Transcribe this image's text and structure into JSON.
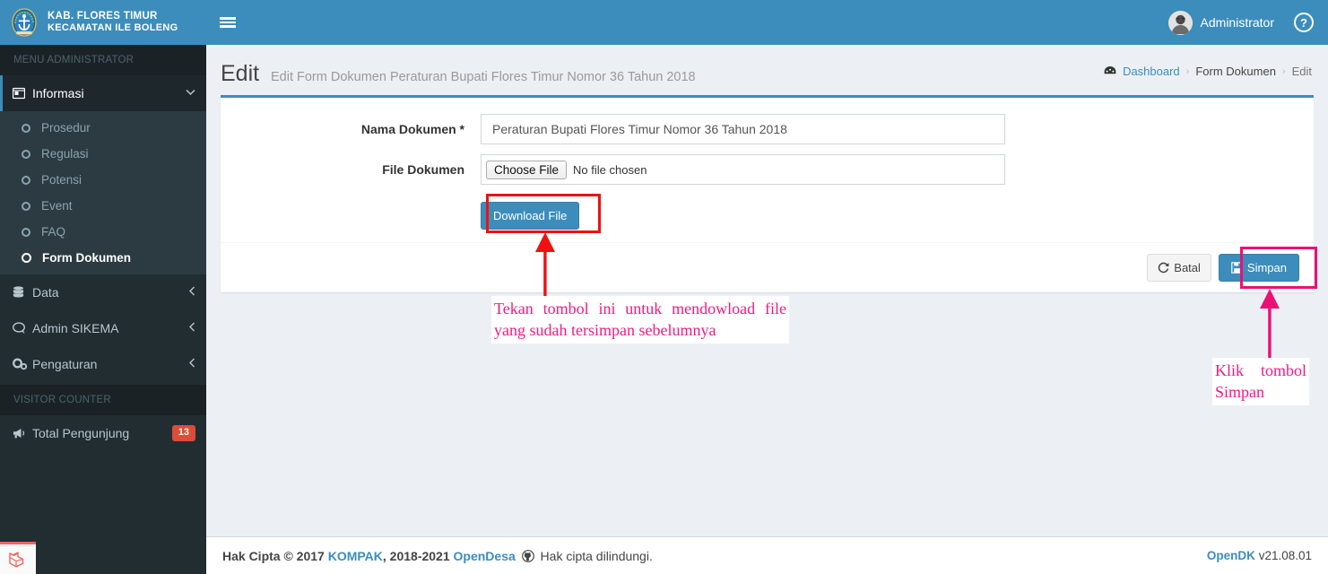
{
  "brand": {
    "line1": "KAB. FLORES TIMUR",
    "line2": "KECAMATAN ILE BOLENG",
    "logo_icon": "regency-emblem-logo"
  },
  "topbar": {
    "menu_toggle_icon": "hamburger-menu-icon",
    "user_name": "Administrator",
    "avatar_icon": "user-avatar",
    "help_icon": "question-circle-icon",
    "bg_color": "#3c8dbc"
  },
  "sidebar": {
    "section_menu": "MENU ADMINISTRATOR",
    "section_visitor": "VISITOR COUNTER",
    "items": [
      {
        "label": "Informasi",
        "icon": "window-icon",
        "arrow": "chevron-down-icon",
        "active": true
      },
      {
        "label": "Data",
        "icon": "database-icon",
        "arrow": "chevron-left-icon",
        "active": false
      },
      {
        "label": "Admin SIKEMA",
        "icon": "comment-icon",
        "arrow": "chevron-left-icon",
        "active": false
      },
      {
        "label": "Pengaturan",
        "icon": "gears-icon",
        "arrow": "chevron-left-icon",
        "active": false
      }
    ],
    "submenu": [
      {
        "label": "Prosedur",
        "active": false
      },
      {
        "label": "Regulasi",
        "active": false
      },
      {
        "label": "Potensi",
        "active": false
      },
      {
        "label": "Event",
        "active": false
      },
      {
        "label": "FAQ",
        "active": false
      },
      {
        "label": "Form Dokumen",
        "active": true
      }
    ],
    "visitor": {
      "label": "Total Pengunjung",
      "icon": "bullhorn-icon",
      "count": "13",
      "count_color": "#dd4b39"
    },
    "debugbar_icon": "laravel-debugbar-icon"
  },
  "page": {
    "title": "Edit",
    "subtitle": "Edit Form Dokumen Peraturan Bupati Flores Timur Nomor 36 Tahun 2018"
  },
  "breadcrumb": {
    "home_icon": "dashboard-icon",
    "items": [
      "Dashboard",
      "Form Dokumen",
      "Edit"
    ],
    "separator": "›"
  },
  "form": {
    "nama_dokumen": {
      "label": "Nama Dokumen *",
      "value": "Peraturan Bupati Flores Timur Nomor 36 Tahun 2018",
      "placeholder": "Nama Dokumen"
    },
    "file_dokumen": {
      "label": "File Dokumen",
      "button_label": "Choose File",
      "file_status": "No file chosen"
    },
    "download_button": "Download File"
  },
  "card_footer": {
    "cancel_label": "Batal",
    "cancel_icon": "refresh-icon",
    "save_label": "Simpan",
    "save_icon": "floppy-save-icon"
  },
  "footer": {
    "copyright_prefix": "Hak Cipta © 2017 ",
    "kompak": "KOMPAK",
    "years": ", 2018-2021 ",
    "opendesa": "OpenDesa",
    "github_icon": "github-icon",
    "rights": " Hak cipta dilindungi.",
    "product": "OpenDK",
    "version": "v21.08.01"
  },
  "annotations": {
    "download_note": "Tekan tombol ini untuk mendowload file yang sudah tersimpan sebelumnya",
    "save_note": "Klik tombol Simpan",
    "download_box_color": "#ee1111",
    "save_box_color": "#ec1075",
    "text_color": "#f5197f"
  }
}
